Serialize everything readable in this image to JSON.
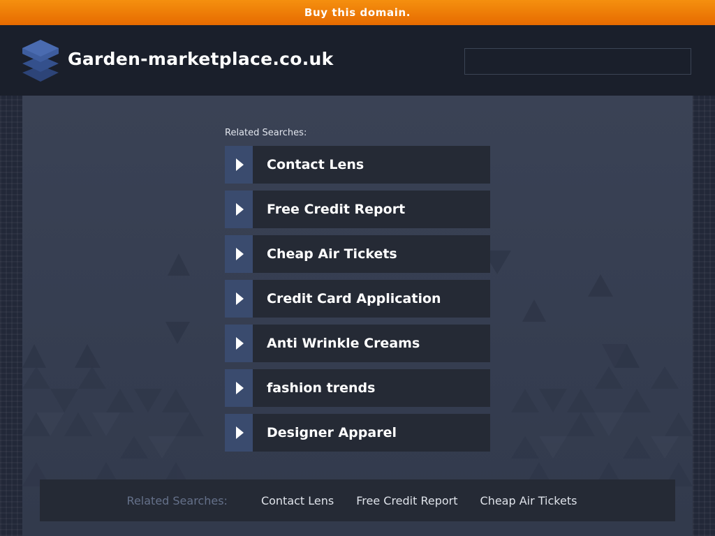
{
  "banner": {
    "text": "Buy this domain."
  },
  "header": {
    "title": "Garden-marketplace.co.uk",
    "search_value": "",
    "search_placeholder": ""
  },
  "main": {
    "related_heading": "Related Searches:",
    "links": [
      {
        "label": "Contact Lens"
      },
      {
        "label": "Free Credit Report"
      },
      {
        "label": "Cheap Air Tickets"
      },
      {
        "label": "Credit Card Application"
      },
      {
        "label": "Anti Wrinkle Creams"
      },
      {
        "label": "fashion trends"
      },
      {
        "label": "Designer Apparel"
      }
    ]
  },
  "footer": {
    "label": "Related Searches:",
    "links": [
      {
        "label": "Contact Lens"
      },
      {
        "label": "Free Credit Report"
      },
      {
        "label": "Cheap Air Tickets"
      }
    ]
  },
  "colors": {
    "banner": "#f08a0a",
    "header_bg": "#1a1f2b",
    "content_bg": "#3a4255",
    "link_box": "#252a35",
    "arrow_box": "#3a4b6e"
  },
  "icons": {
    "logo": "stacked-layers-icon",
    "link_arrow": "play-arrow-icon"
  }
}
